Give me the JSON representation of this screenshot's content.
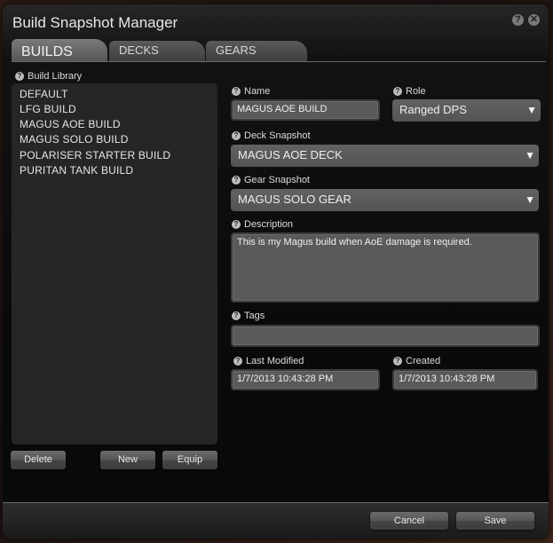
{
  "window": {
    "title": "Build Snapshot Manager",
    "help_icon": "?",
    "close_icon": "✕"
  },
  "tabs": [
    {
      "label": "BUILDS",
      "active": true
    },
    {
      "label": "DECKS",
      "active": false
    },
    {
      "label": "GEARS",
      "active": false
    }
  ],
  "library": {
    "label": "Build Library",
    "items": [
      "DEFAULT",
      "LFG BUILD",
      "MAGUS AOE BUILD",
      "MAGUS SOLO BUILD",
      "POLARISER STARTER BUILD",
      "PURITAN TANK BUILD"
    ],
    "buttons": {
      "delete": "Delete",
      "new": "New",
      "equip": "Equip"
    }
  },
  "form": {
    "name": {
      "label": "Name",
      "value": "MAGUS AOE BUILD"
    },
    "role": {
      "label": "Role",
      "value": "Ranged DPS"
    },
    "deck": {
      "label": "Deck Snapshot",
      "value": "MAGUS AOE DECK"
    },
    "gear": {
      "label": "Gear Snapshot",
      "value": "MAGUS SOLO GEAR"
    },
    "description": {
      "label": "Description",
      "value": "This is my Magus build when AoE damage is required."
    },
    "tags": {
      "label": "Tags",
      "value": ""
    },
    "last_modified": {
      "label": "Last Modified",
      "value": "1/7/2013 10:43:28 PM"
    },
    "created": {
      "label": "Created",
      "value": "1/7/2013 10:43:28 PM"
    }
  },
  "footer": {
    "cancel": "Cancel",
    "save": "Save"
  },
  "icons": {
    "help": "?",
    "dropdown": "▼"
  }
}
